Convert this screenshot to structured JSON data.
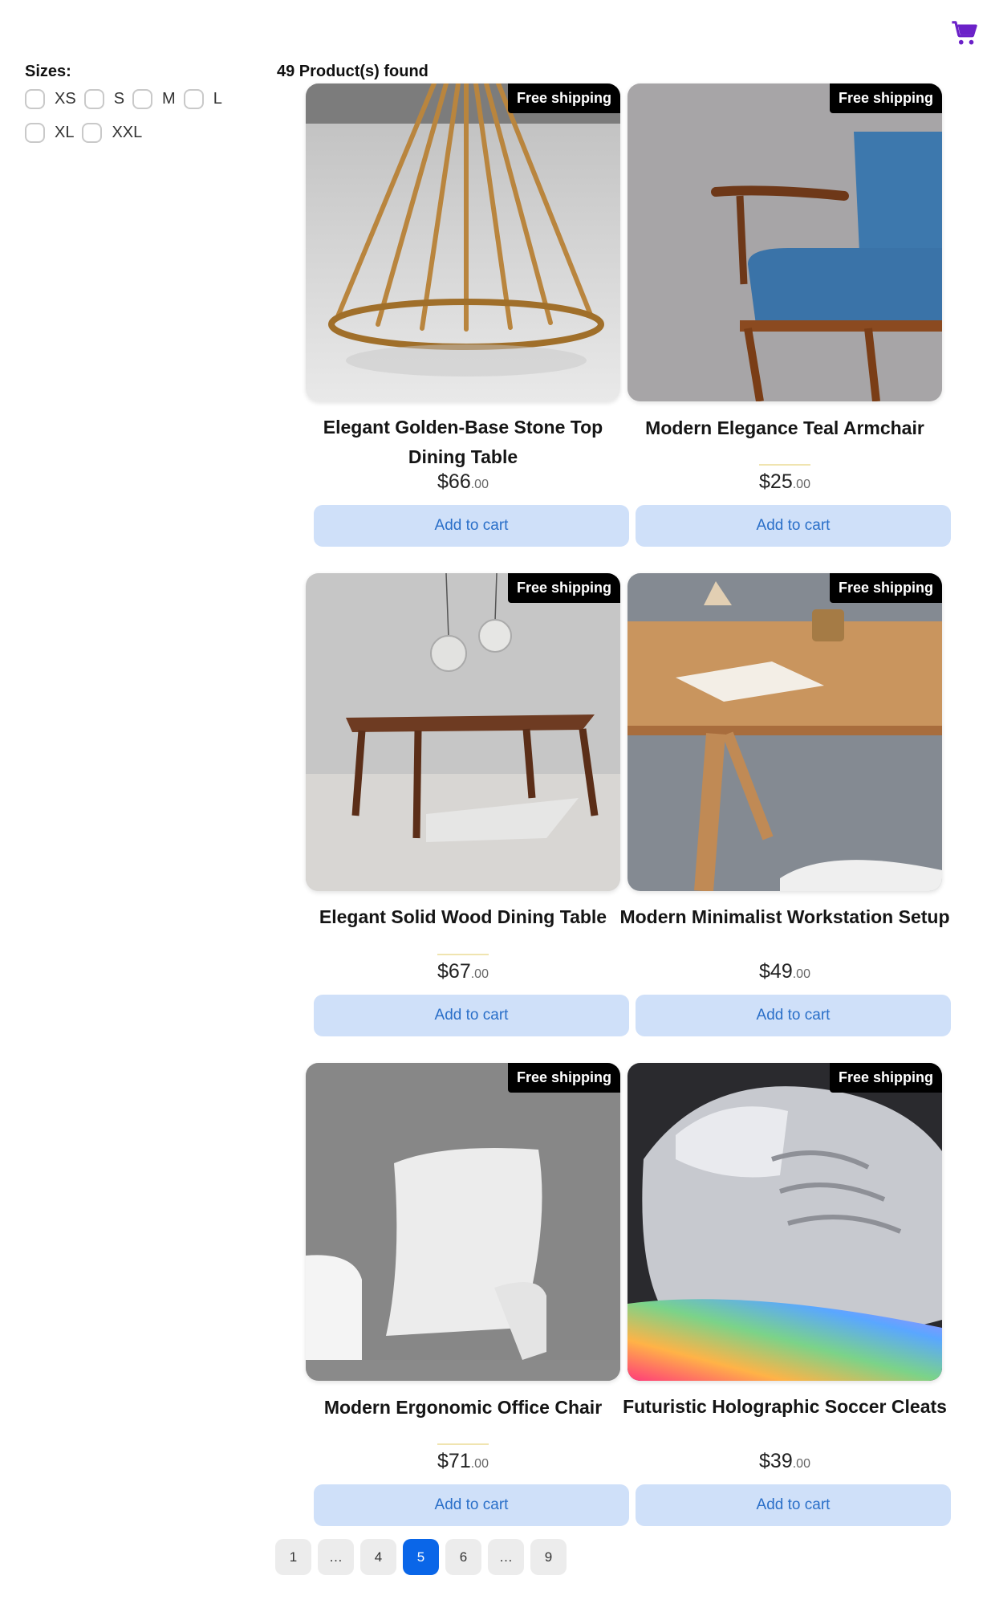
{
  "header": {
    "cart_icon": "shopping-cart-icon",
    "accent_color": "#6b21c8"
  },
  "filters": {
    "title": "Sizes:",
    "sizes": [
      "XS",
      "S",
      "M",
      "L",
      "XL",
      "XXL"
    ]
  },
  "results": {
    "count_text": "49 Product(s) found"
  },
  "products": [
    {
      "badge": "Free shipping",
      "title": "Elegant Golden-Base Stone Top Dining Table",
      "price_main": "$66",
      "price_cents": ".00",
      "button": "Add to cart"
    },
    {
      "badge": "Free shipping",
      "title": "Modern Elegance Teal Armchair",
      "price_main": "$25",
      "price_cents": ".00",
      "button": "Add to cart"
    },
    {
      "badge": "Free shipping",
      "title": "Elegant Solid Wood Dining Table",
      "price_main": "$67",
      "price_cents": ".00",
      "button": "Add to cart"
    },
    {
      "badge": "Free shipping",
      "title": "Modern Minimalist Workstation Setup",
      "price_main": "$49",
      "price_cents": ".00",
      "button": "Add to cart"
    },
    {
      "badge": "Free shipping",
      "title": "Modern Ergonomic Office Chair",
      "price_main": "$71",
      "price_cents": ".00",
      "button": "Add to cart"
    },
    {
      "badge": "Free shipping",
      "title": "Futuristic Holographic Soccer Cleats",
      "price_main": "$39",
      "price_cents": ".00",
      "button": "Add to cart"
    }
  ],
  "pagination": {
    "pages": [
      "1",
      "…",
      "4",
      "5",
      "6",
      "…",
      "9"
    ],
    "current": "5",
    "active_color": "#0a66e8"
  }
}
